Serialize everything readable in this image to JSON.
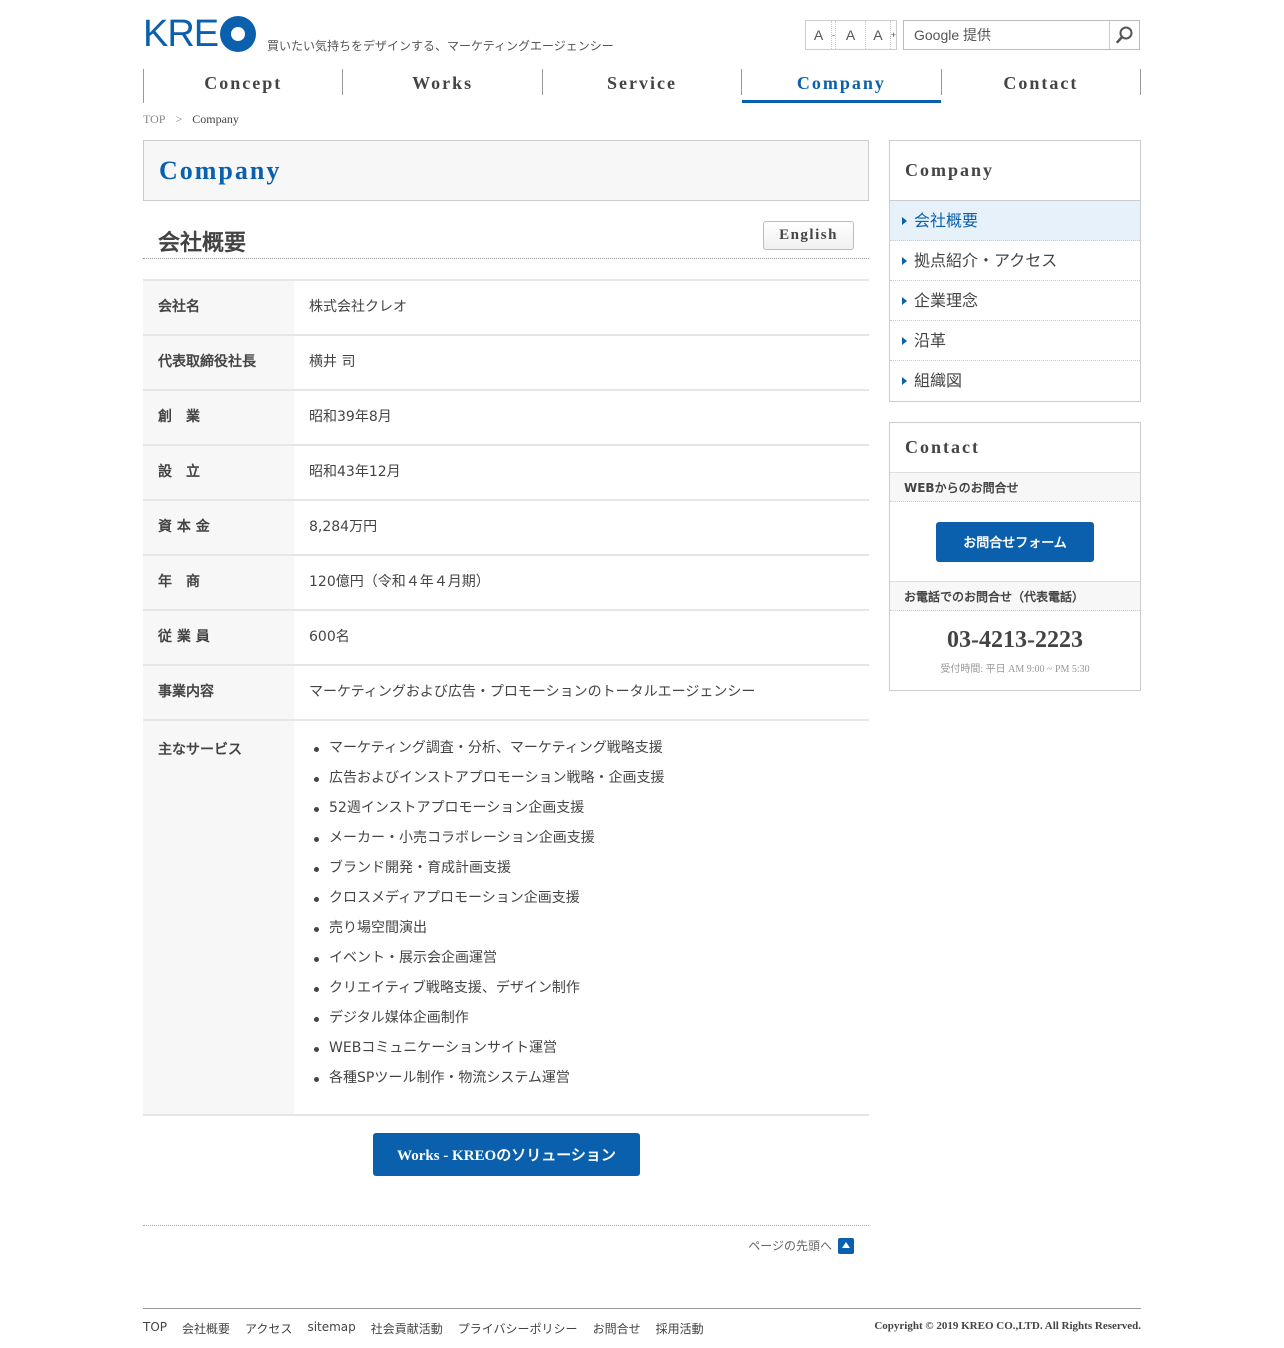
{
  "header": {
    "logo": "KRE",
    "tagline": "買いたい気持ちをデザインする、マーケティングエージェンシー",
    "font_small": "A",
    "font_small_mark": "-",
    "font_medium": "A",
    "font_large": "A",
    "font_large_mark": "+",
    "search_placeholder": "Google 提供",
    "search_icon": "magnifier-icon"
  },
  "nav": [
    {
      "label": "Concept"
    },
    {
      "label": "Works"
    },
    {
      "label": "Service"
    },
    {
      "label": "Company",
      "active": true
    },
    {
      "label": "Contact"
    }
  ],
  "breadcrumb": {
    "top": "TOP",
    "sep": ">",
    "current": "Company"
  },
  "main": {
    "page_title": "Company",
    "section_title": "会社概要",
    "english_button": "English",
    "rows": [
      {
        "label": "会社名",
        "value": "株式会社クレオ"
      },
      {
        "label": "代表取締役社長",
        "value": "横井 司"
      },
      {
        "label": "創　業",
        "value": "昭和39年8月"
      },
      {
        "label": "設　立",
        "value": "昭和43年12月"
      },
      {
        "label": "資 本 金",
        "value": "8,284万円"
      },
      {
        "label": "年　商",
        "value": "120億円（令和４年４月期）"
      },
      {
        "label": "従 業 員",
        "value": "600名"
      },
      {
        "label": "事業内容",
        "value": "マーケティングおよび広告・プロモーションのトータルエージェンシー"
      }
    ],
    "services_label": "主なサービス",
    "services": [
      "マーケティング調査・分析、マーケティング戦略支援",
      "広告およびインストアプロモーション戦略・企画支援",
      "52週インストアプロモーション企画支援",
      "メーカー・小売コラボレーション企画支援",
      "ブランド開発・育成計画支援",
      "クロスメディアプロモーション企画支援",
      "売り場空間演出",
      "イベント・展示会企画運営",
      "クリエイティブ戦略支援、デザイン制作",
      "デジタル媒体企画制作",
      "WEBコミュニケーションサイト運営",
      "各種SPツール制作・物流システム運営"
    ],
    "works_button": "Works - KREOのソリューション",
    "page_top": "ページの先頭へ"
  },
  "sidebar": {
    "title": "Company",
    "items": [
      {
        "label": "会社概要",
        "active": true
      },
      {
        "label": "拠点紹介・アクセス"
      },
      {
        "label": "企業理念"
      },
      {
        "label": "沿革"
      },
      {
        "label": "組織図"
      }
    ],
    "contact": {
      "title": "Contact",
      "web_label": "WEBからのお問合せ",
      "form_button": "お問合せフォーム",
      "tel_label": "お電話でのお問合せ（代表電話）",
      "tel": "03-4213-2223",
      "hours": "受付時間: 平日 AM 9:00 ~ PM 5:30"
    }
  },
  "footer": {
    "links": [
      "TOP",
      "会社概要",
      "アクセス",
      "sitemap",
      "社会貢献活動",
      "プライバシーポリシー",
      "お問合せ",
      "採用活動"
    ],
    "copyright": "Copyright © 2019 KREO CO.,LTD. All Rights Reserved."
  },
  "colors": {
    "accent": "#0a60ad",
    "active_bg": "#e6f1fa"
  }
}
